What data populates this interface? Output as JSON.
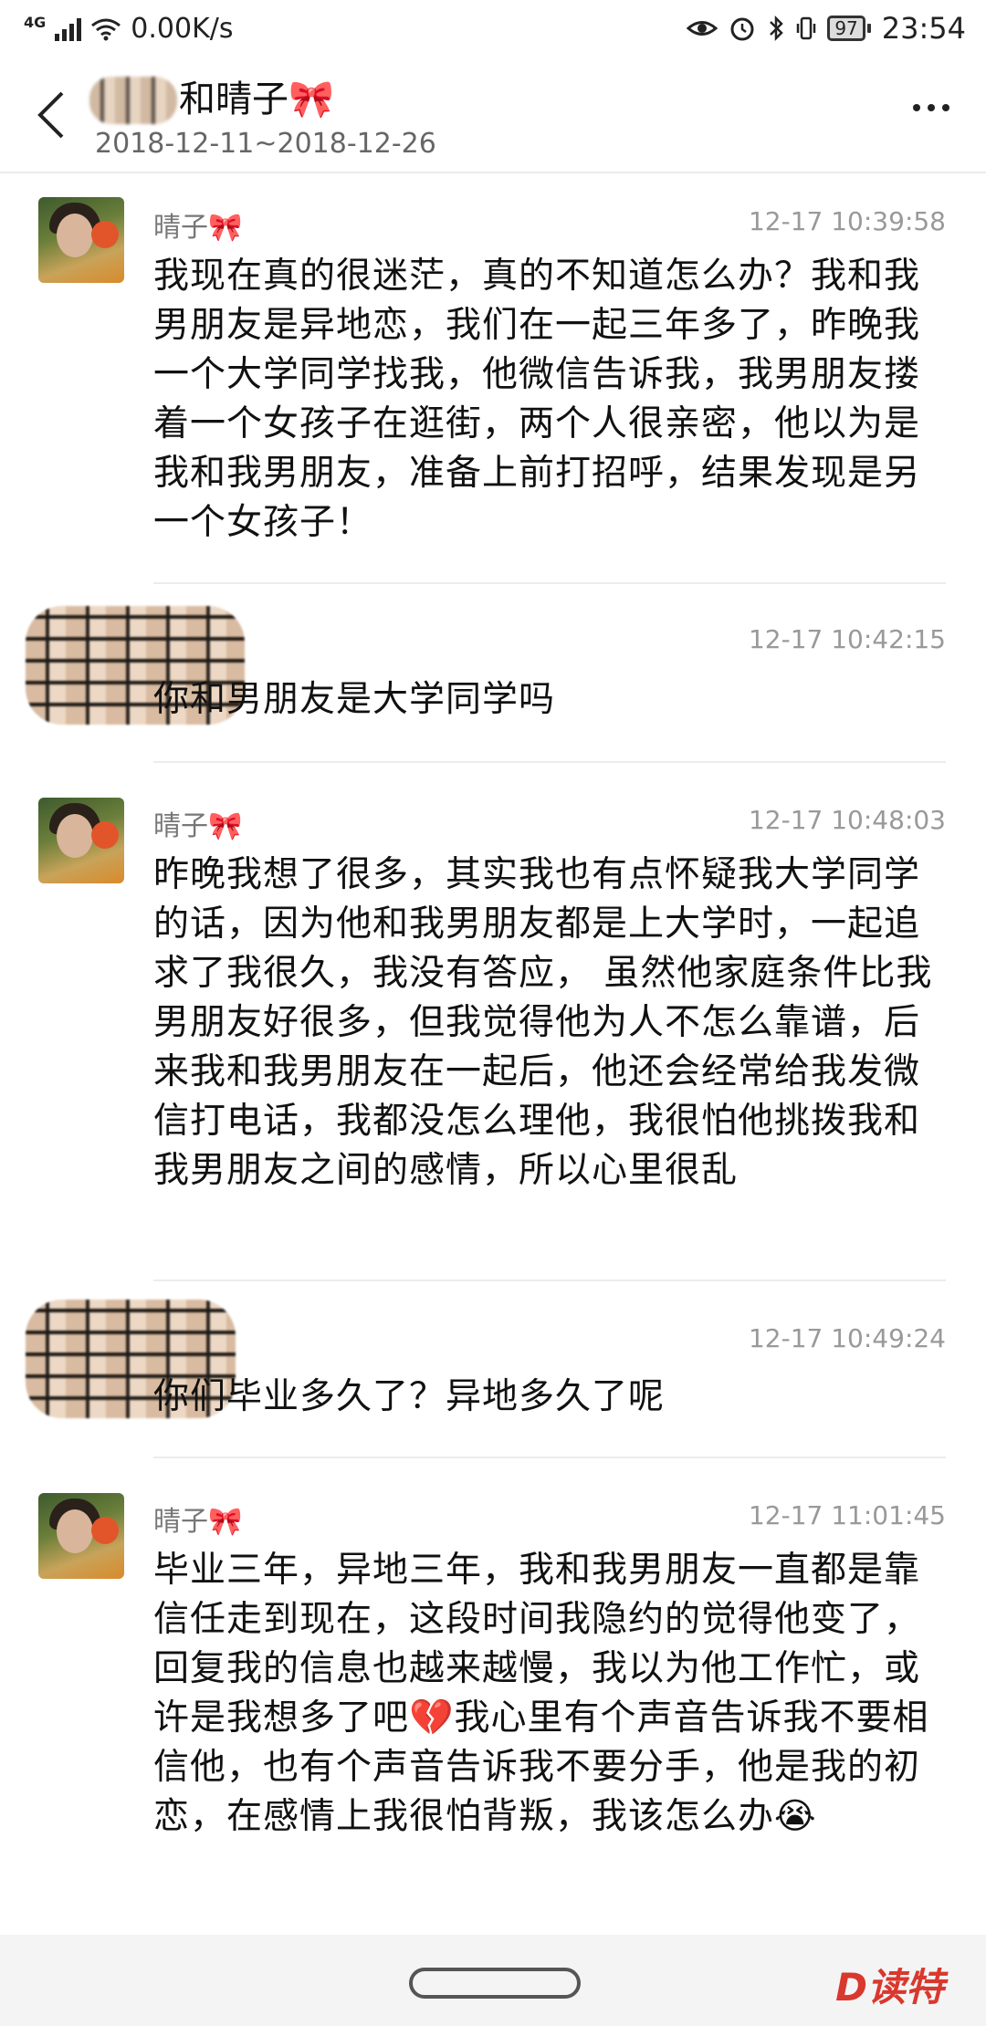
{
  "status_bar": {
    "network": "4G",
    "speed": "0.00K/s",
    "battery": "97",
    "time": "23:54"
  },
  "header": {
    "title": "和晴子🎀",
    "date_range": "2018-12-11~2018-12-26"
  },
  "messages": [
    {
      "sender": "晴子🎀",
      "time": "12-17 10:39:58",
      "text": "我现在真的很迷茫，真的不知道怎么办？我和我男朋友是异地恋，我们在一起三年多了，昨晚我一个大学同学找我，他微信告诉我，我男朋友搂着一个女孩子在逛街，两个人很亲密，他以为是我和我男朋友，准备上前打招呼，结果发现是另一个女孩子！"
    },
    {
      "sender": "",
      "time": "12-17 10:42:15",
      "text": "你和男朋友是大学同学吗"
    },
    {
      "sender": "晴子🎀",
      "time": "12-17 10:48:03",
      "text": "昨晚我想了很多，其实我也有点怀疑我大学同学的话，因为他和我男朋友都是上大学时，一起追求了我很久，我没有答应， 虽然他家庭条件比我男朋友好很多，但我觉得他为人不怎么靠谱，后来我和我男朋友在一起后，他还会经常给我发微信打电话，我都没怎么理他，我很怕他挑拨我和我男朋友之间的感情，所以心里很乱"
    },
    {
      "sender": "",
      "time": "12-17 10:49:24",
      "text": "你们毕业多久了？异地多久了呢"
    },
    {
      "sender": "晴子🎀",
      "time": "12-17 11:01:45",
      "text": "毕业三年，异地三年，我和我男朋友一直都是靠信任走到现在，这段时间我隐约的觉得他变了，回复我的信息也越来越慢，我以为他工作忙，或许是我想多了吧💔我心里有个声音告诉我不要相信他，也有个声音告诉我不要分手，他是我的初恋，在感情上我很怕背叛，我该怎么办😭"
    }
  ],
  "watermark": "D读特",
  "colors": {
    "accent_watermark": "#d9382e",
    "divider": "#ececec",
    "meta_text": "#999999"
  }
}
